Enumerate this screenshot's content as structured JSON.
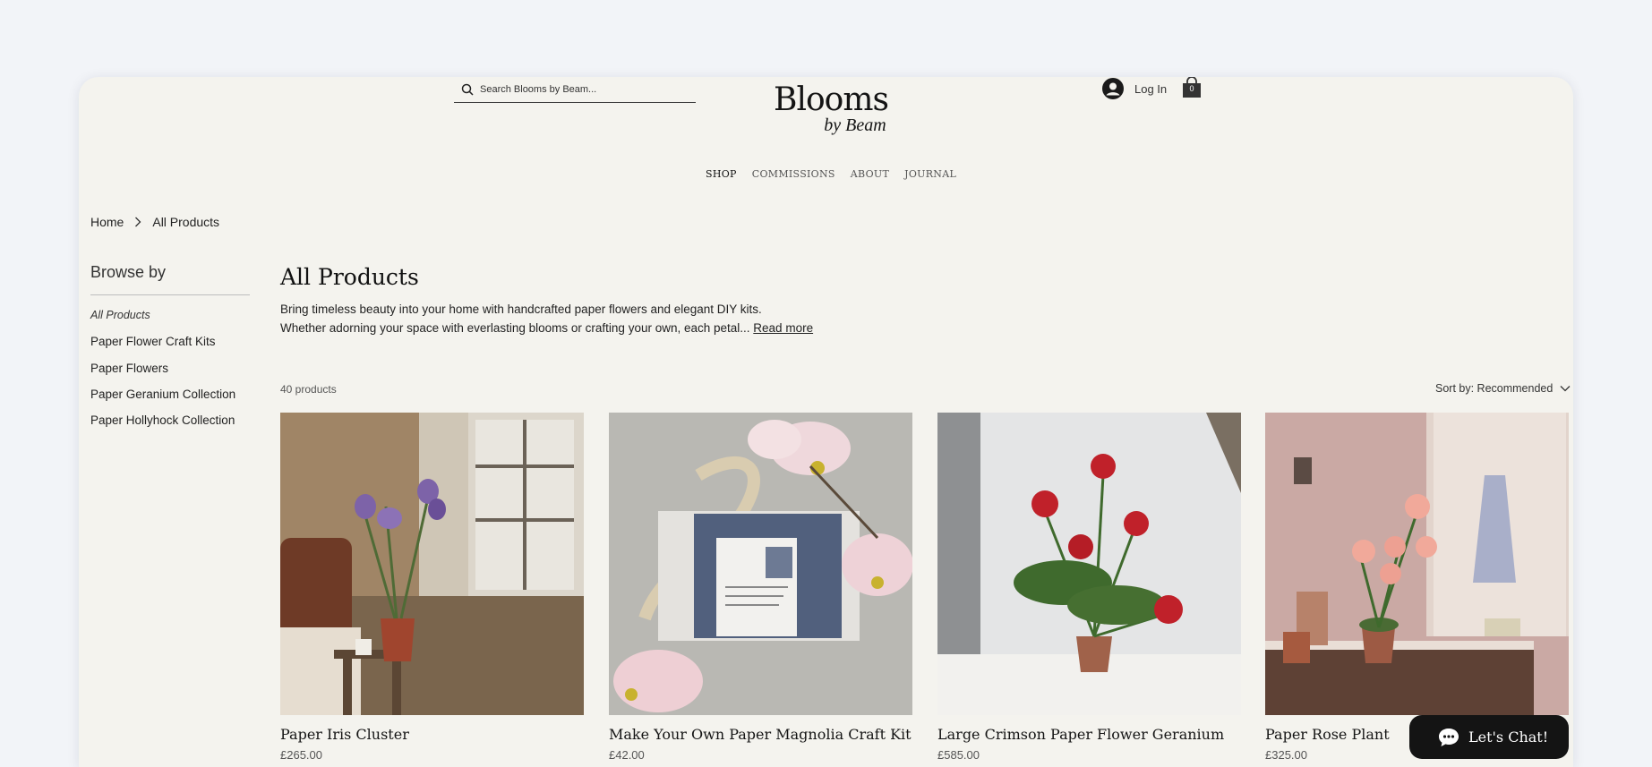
{
  "header": {
    "search_placeholder": "Search Blooms by Beam...",
    "logo_main": "Blooms",
    "logo_sub": "by Beam",
    "login_label": "Log In",
    "cart_count": "0"
  },
  "nav": [
    "SHOP",
    "COMMISSIONS",
    "ABOUT",
    "JOURNAL"
  ],
  "breadcrumb": {
    "home": "Home",
    "current": "All Products"
  },
  "sidebar": {
    "title": "Browse by",
    "items": [
      "All Products",
      "Paper Flower Craft Kits",
      "Paper Flowers",
      "Paper Geranium Collection",
      "Paper Hollyhock Collection"
    ]
  },
  "main": {
    "title": "All Products",
    "desc_line1": "Bring timeless beauty into your home with handcrafted paper flowers and elegant DIY kits.",
    "desc_line2": "Whether adorning your space with everlasting blooms or crafting your own, each petal...",
    "read_more": "Read more",
    "count": "40 products",
    "sort_label": "Sort by: Recommended"
  },
  "products": [
    {
      "name": "Paper Iris Cluster",
      "price": "£265.00"
    },
    {
      "name": "Make Your Own Paper Magnolia Craft Kit",
      "price": "£42.00"
    },
    {
      "name": "Large Crimson Paper Flower Geranium",
      "price": "£585.00"
    },
    {
      "name": "Paper Rose Plant",
      "price": "£325.00"
    }
  ],
  "chat": {
    "label": "Let's Chat!"
  },
  "colors": {
    "background": "#f2f4f8",
    "page": "#f4f3ee",
    "text": "#1f1f1f",
    "chat_bg": "#141414"
  }
}
